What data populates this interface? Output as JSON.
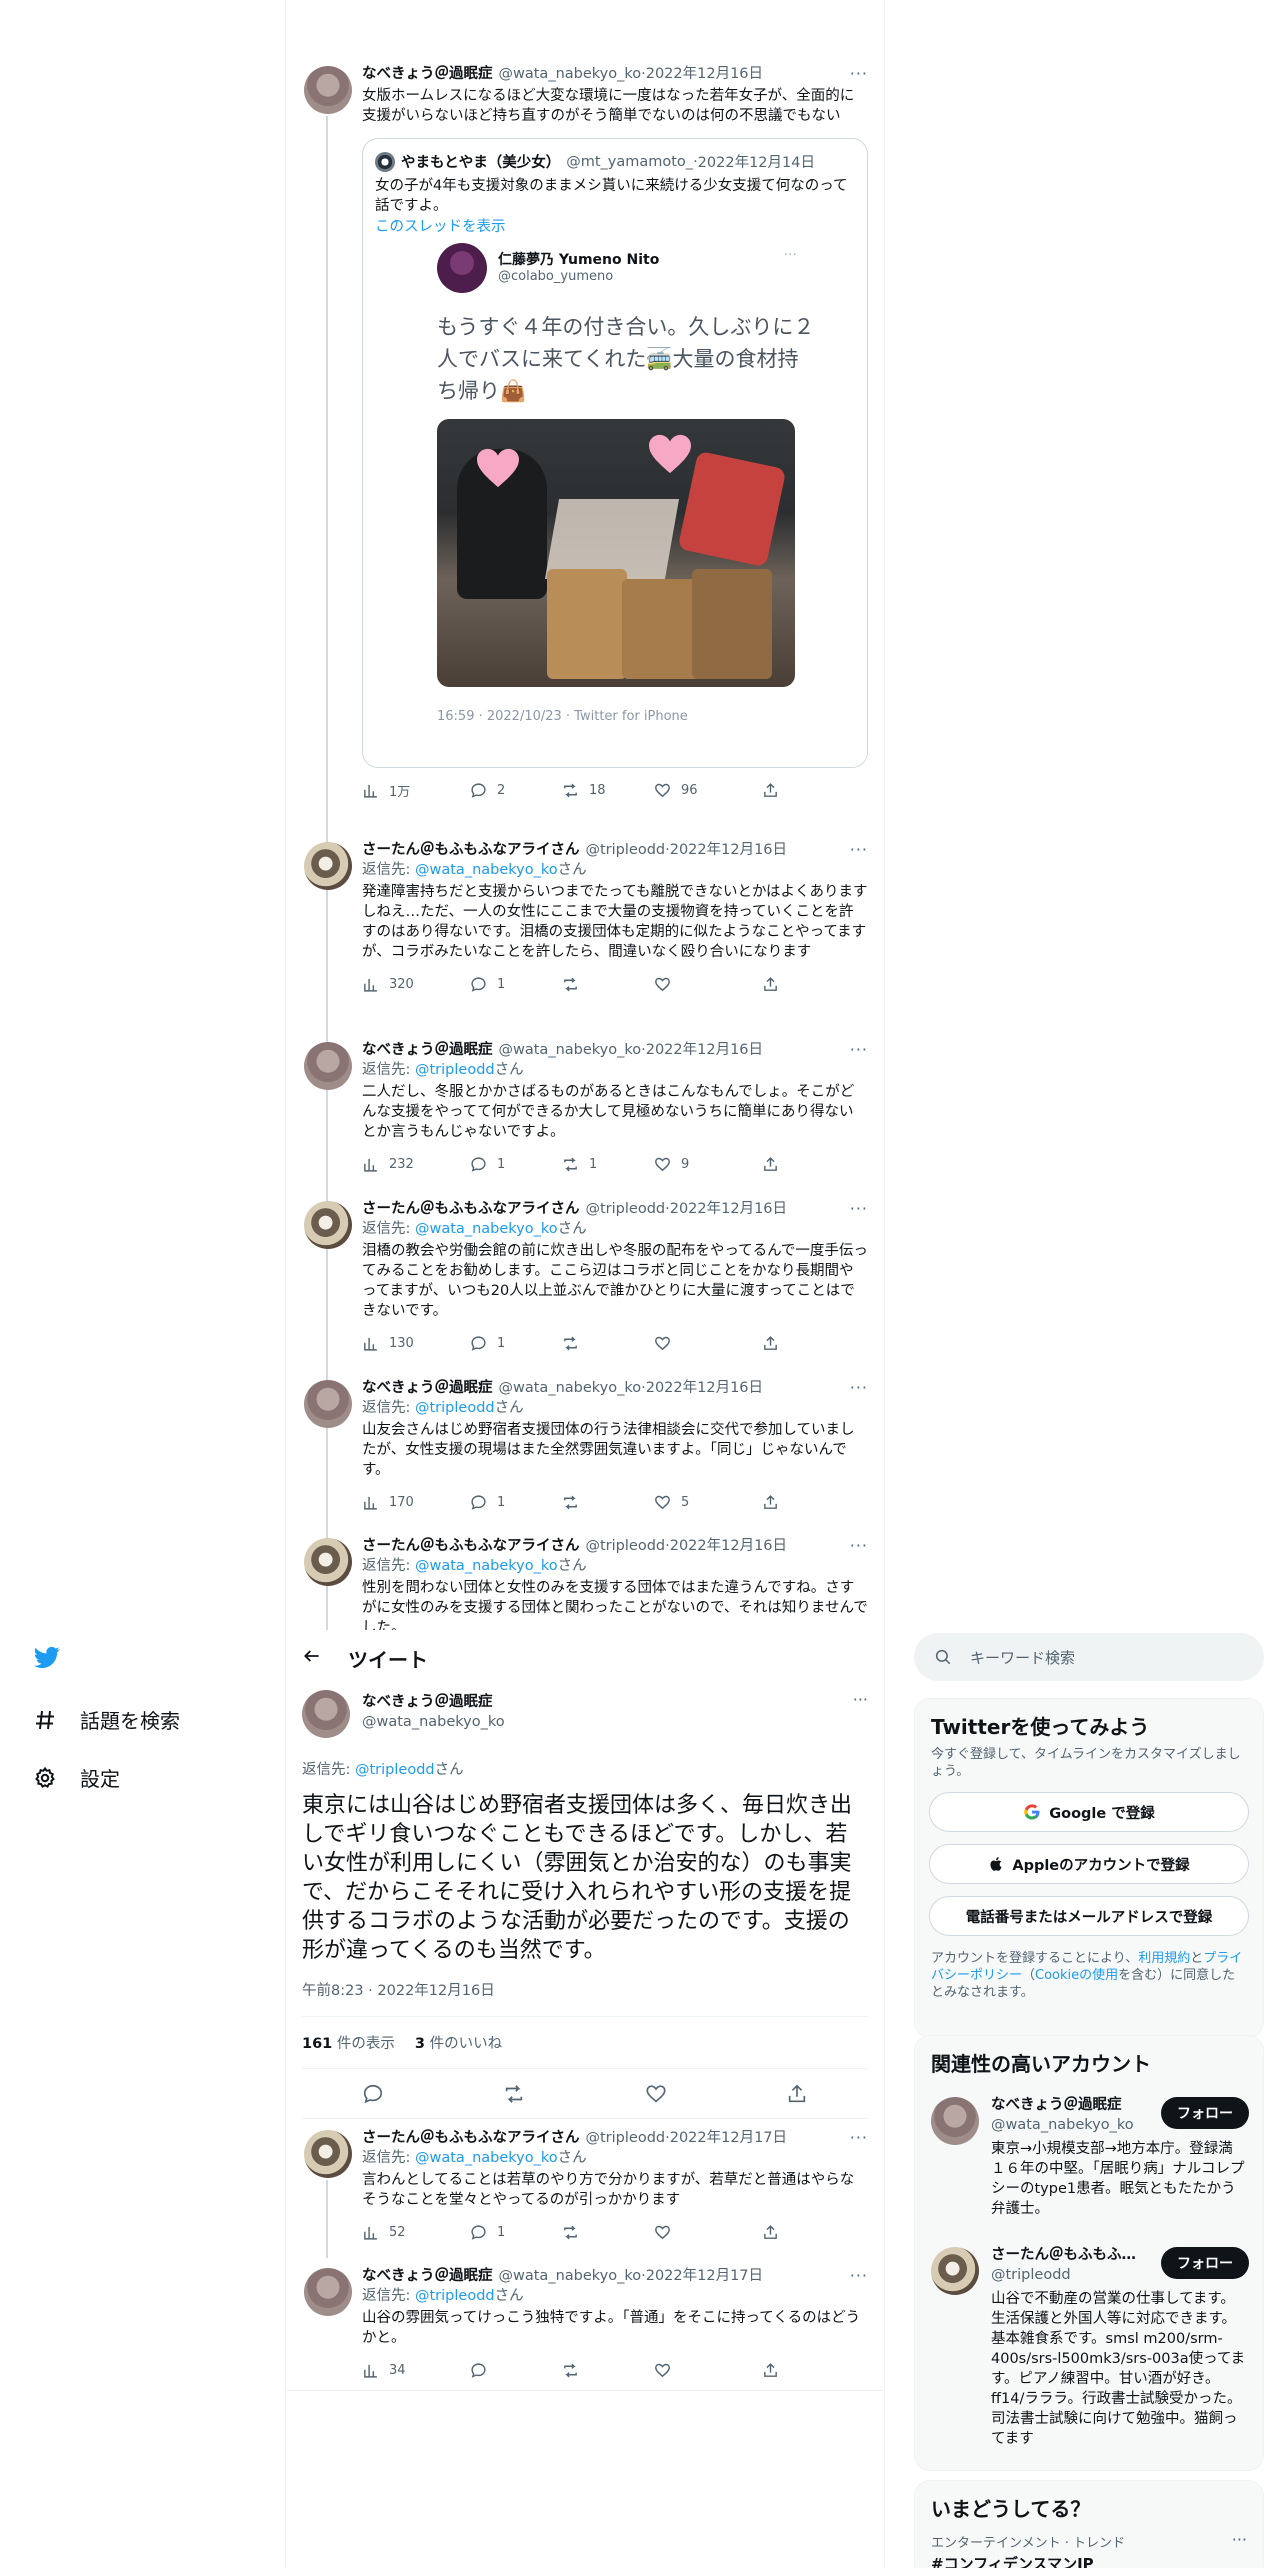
{
  "nav": {
    "explore_label": "話題を検索",
    "settings_label": "設定",
    "brand_color": "#1d9bf0"
  },
  "header": {
    "title": "ツイート"
  },
  "thread": [
    {
      "name": "なべきょう＠過眠症",
      "handle": "@wata_nabekyo_ko",
      "date": "2022年12月16日",
      "text": "女版ホームレスになるほど大変な環境に一度はなった若年女子が、全面的に支援がいらないほど持ち直すのがそう簡単でないのは何の不思議でもない",
      "views": "1万",
      "replies": "2",
      "retweets": "18",
      "likes": "96"
    },
    {
      "name": "さーたん＠もふもふなアライさん",
      "handle": "@tripleodd",
      "date": "2022年12月16日",
      "reply_prefix": "返信先: ",
      "reply_to": "@wata_nabekyo_ko",
      "reply_suffix": "さん",
      "text": "発達障害持ちだと支援からいつまでたっても離脱できないとかはよくありますしねえ…ただ、一人の女性にここまで大量の支援物資を持っていくことを許すのはあり得ないです。泪橋の支援団体も定期的に似たようなことやってますが、コラボみたいなことを許したら、間違いなく殴り合いになります",
      "views": "320",
      "replies": "1",
      "retweets": "",
      "likes": ""
    },
    {
      "name": "なべきょう＠過眠症",
      "handle": "@wata_nabekyo_ko",
      "date": "2022年12月16日",
      "reply_prefix": "返信先: ",
      "reply_to": "@tripleodd",
      "reply_suffix": "さん",
      "text": "二人だし、冬服とかかさばるものがあるときはこんなもんでしょ。そこがどんな支援をやってて何ができるか大して見極めないうちに簡単にあり得ないとか言うもんじゃないですよ。",
      "views": "232",
      "replies": "1",
      "retweets": "1",
      "likes": "9"
    },
    {
      "name": "さーたん＠もふもふなアライさん",
      "handle": "@tripleodd",
      "date": "2022年12月16日",
      "reply_prefix": "返信先: ",
      "reply_to": "@wata_nabekyo_ko",
      "reply_suffix": "さん",
      "text": "泪橋の教会や労働会館の前に炊き出しや冬服の配布をやってるんで一度手伝ってみることをお勧めします。ここら辺はコラボと同じことをかなり長期間やってますが、いつも20人以上並ぶんで誰かひとりに大量に渡すってことはできないです。",
      "views": "130",
      "replies": "1",
      "retweets": "",
      "likes": ""
    },
    {
      "name": "なべきょう＠過眠症",
      "handle": "@wata_nabekyo_ko",
      "date": "2022年12月16日",
      "reply_prefix": "返信先: ",
      "reply_to": "@tripleodd",
      "reply_suffix": "さん",
      "text": "山友会さんはじめ野宿者支援団体の行う法律相談会に交代で参加していましたが、女性支援の現場はまた全然雰囲気違いますよ。「同じ」じゃないんです。",
      "views": "170",
      "replies": "1",
      "retweets": "",
      "likes": "5"
    },
    {
      "name": "さーたん＠もふもふなアライさん",
      "handle": "@tripleodd",
      "date": "2022年12月16日",
      "reply_prefix": "返信先: ",
      "reply_to": "@wata_nabekyo_ko",
      "reply_suffix": "さん",
      "text": "性別を問わない団体と女性のみを支援する団体ではまた違うんですね。さすがに女性のみを支援する団体と関わったことがないので、それは知りませんでした。"
    }
  ],
  "quote": {
    "name": "やまもとやま（美少女）",
    "handle": "@mt_yamamoto_",
    "date": "2022年12月14日",
    "text": "女の子が4年も支援対象のままメシ貰いに来続ける少女支援て何なのって話ですよ。",
    "link": "このスレッドを表示",
    "inner_name": "仁藤夢乃 Yumeno Nito",
    "inner_handle": "@colabo_yumeno",
    "inner_text": "もうすぐ４年の付き合い。久しぶりに２人でバスに来てくれた🚎大量の食材持ち帰り👜",
    "inner_meta": "16:59 · 2022/10/23 · Twitter for iPhone"
  },
  "focal": {
    "name": "なべきょう＠過眠症",
    "handle": "@wata_nabekyo_ko",
    "reply_prefix": "返信先: ",
    "reply_to": "@tripleodd",
    "reply_suffix": "さん",
    "text": "東京には山谷はじめ野宿者支援団体は多く、毎日炊き出しでギリ食いつなぐこともできるほどです。しかし、若い女性が利用しにくい（雰囲気とか治安的な）のも事実で、だからこそそれに受け入れられやすい形の支援を提供するコラボのような活動が必要だったのです。支援の形が違ってくるのも当然です。",
    "time": "午前8:23 · 2022年12月16日",
    "views_count": "161",
    "views_label": "件の表示",
    "likes_count": "3",
    "likes_label": "件のいいね"
  },
  "replies": [
    {
      "name": "さーたん＠もふもふなアライさん",
      "handle": "@tripleodd",
      "date": "2022年12月17日",
      "reply_prefix": "返信先: ",
      "reply_to": "@wata_nabekyo_ko",
      "reply_suffix": "さん",
      "text": "言わんとしてることは若草のやり方で分かりますが、若草だと普通はやらなそうなことを堂々とやってるのが引っかかります",
      "views": "52",
      "replies": "1",
      "retweets": "",
      "likes": ""
    },
    {
      "name": "なべきょう＠過眠症",
      "handle": "@wata_nabekyo_ko",
      "date": "2022年12月17日",
      "reply_prefix": "返信先: ",
      "reply_to": "@tripleodd",
      "reply_suffix": "さん",
      "text": "山谷の雰囲気ってけっこう独特ですよ。「普通」をそこに持ってくるのはどうかと。",
      "views": "34",
      "replies": "",
      "retweets": "",
      "likes": ""
    }
  ],
  "sidebar": {
    "search_placeholder": "キーワード検索",
    "signup": {
      "title": "Twitterを使ってみよう",
      "subtitle": "今すぐ登録して、タイムラインをカスタマイズしましょう。",
      "google_label": "Google で登録",
      "apple_label": "Appleのアカウントで登録",
      "phone_label": "電話番号またはメールアドレスで登録",
      "legal_prefix": "アカウントを登録することにより、",
      "legal_terms": "利用規約",
      "legal_and": "と",
      "legal_privacy": "プライバシーポリシー",
      "legal_cookie_open": "（",
      "legal_cookie": "Cookieの使用",
      "legal_suffix": "を含む）に同意したとみなされます。"
    },
    "relevant": {
      "title": "関連性の高いアカウント",
      "follow_label": "フォロー",
      "accounts": [
        {
          "name": "なべきょう＠過眠症",
          "handle": "@wata_nabekyo_ko",
          "bio": "東京→小規模支部→地方本庁。登録満１６年の中堅。「居眠り病」ナルコレプシーのtype1患者。眠気ともたたかう弁護士。"
        },
        {
          "name": "さーたん＠もふもふなアライさん",
          "handle": "@tripleodd",
          "bio": "山谷で不動産の営業の仕事してます。生活保護と外国人等に対応できます。基本雑食系です。smsl m200/srm-400s/srs-l500mk3/srs-003a使ってます。ピアノ練習中。甘い酒が好き。ff14/ラララ。行政書士試験受かった。司法書士試験に向けて勉強中。猫飼ってます"
        }
      ]
    },
    "trends": {
      "title": "いまどうしてる？",
      "items": [
        {
          "category": "エンターテインメント · トレンド",
          "name": "#コンフィデンスマンJP"
        }
      ]
    }
  }
}
